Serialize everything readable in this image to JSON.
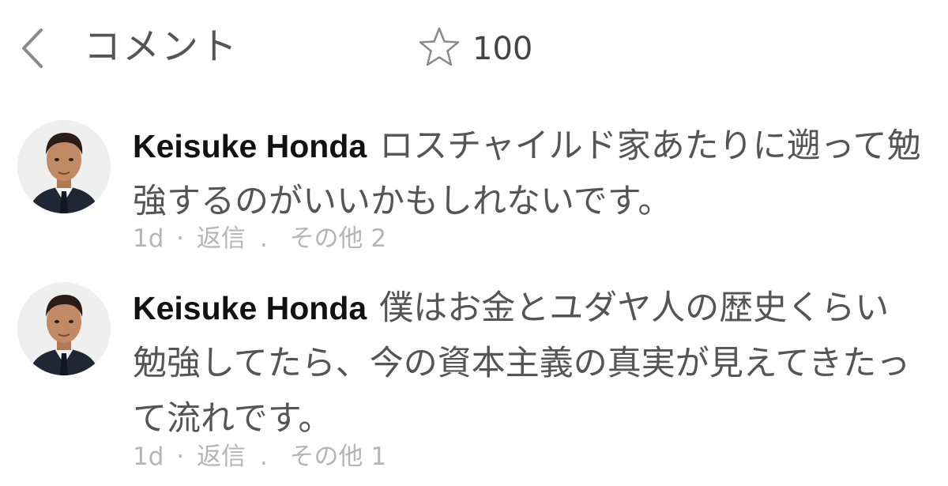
{
  "header": {
    "back_icon": "chevron-left-icon",
    "title": "コメント",
    "star_icon": "star-outline-icon",
    "star_count": "100"
  },
  "comments": [
    {
      "author": "Keisuke Honda",
      "text": "ロスチャイルド家あたりに遡って勉強するのがいいかもしれないです。",
      "time": "1d",
      "dot": "·",
      "reply": "返信",
      "comma": ".",
      "more": "その他 2"
    },
    {
      "author": "Keisuke Honda",
      "text": "僕はお金とユダヤ人の歴史くらい勉強してたら、今の資本主義の真実が見えてきたって流れです。",
      "time": "1d",
      "dot": "·",
      "reply": "返信",
      "comma": ".",
      "more": "その他 1"
    }
  ],
  "colors": {
    "header_text": "#555555",
    "author": "#111111",
    "body_text": "#555555",
    "meta_text": "#b5b5b5"
  }
}
